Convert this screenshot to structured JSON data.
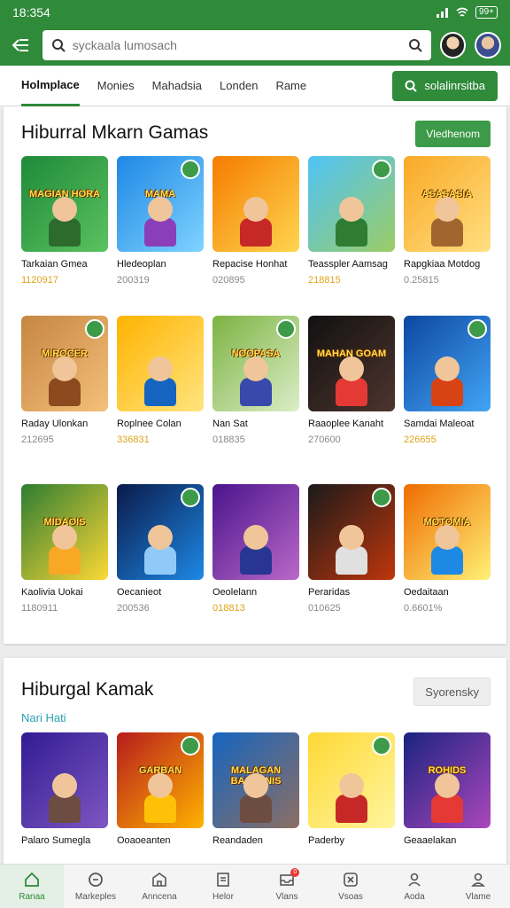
{
  "status": {
    "time": "18:354",
    "battery": "99+"
  },
  "search": {
    "placeholder": "syckaala lumosach"
  },
  "nav": {
    "tabs": [
      "Holmplace",
      "Monies",
      "Mahadsia",
      "Londen",
      "Rame"
    ],
    "cta_label": "solalinrsitba"
  },
  "section1": {
    "title": "Hiburral Mkarn Gamas",
    "button_label": "Vledhenom",
    "tiles": [
      {
        "name": "Tarkaian Gmea",
        "meta": "1120917",
        "art": "MAGIAN HORA",
        "colors": [
          "#1e8a3a",
          "#5bc25f"
        ],
        "body": "#2d6b2d"
      },
      {
        "name": "Hledeoplan",
        "meta": "200319",
        "art": "MAMA",
        "colors": [
          "#1e88e5",
          "#7fd3ff"
        ],
        "body": "#8a3fb8"
      },
      {
        "name": "Repacise Honhat",
        "meta": "020895",
        "art": "",
        "colors": [
          "#f57c00",
          "#ffd54f"
        ],
        "body": "#c62828"
      },
      {
        "name": "Teasspler Aamsag",
        "meta": "218815",
        "art": "",
        "colors": [
          "#4fc3f7",
          "#9ccc65"
        ],
        "body": "#2e7d32"
      },
      {
        "name": "Rapgkiaa Motdog",
        "meta": "0.25815",
        "art": "ASASASIA",
        "colors": [
          "#f9a825",
          "#ffe082"
        ],
        "body": "#a1662f"
      },
      {
        "name": "Raday Ulonkan",
        "meta": "212695",
        "art": "MIROCER",
        "colors": [
          "#c68642",
          "#f4c07a"
        ],
        "body": "#8d4a1f"
      },
      {
        "name": "Roplnee Colan",
        "meta": "336831",
        "art": "",
        "colors": [
          "#ffb300",
          "#ffe57f"
        ],
        "body": "#1565c0"
      },
      {
        "name": "Nan Sat",
        "meta": "018835",
        "art": "NOOPASA",
        "colors": [
          "#7cb342",
          "#dcedc8"
        ],
        "body": "#3949ab"
      },
      {
        "name": "Raaoplee Kanaht",
        "meta": "270600",
        "art": "MAHAN GOAM",
        "colors": [
          "#111111",
          "#4e342e"
        ],
        "body": "#e53935"
      },
      {
        "name": "Samdai Maleoat",
        "meta": "226655",
        "art": "",
        "colors": [
          "#0d47a1",
          "#42a5f5"
        ],
        "body": "#d84315"
      },
      {
        "name": "Kaolivia Uokai",
        "meta": "1180911",
        "art": "MIDAOIS",
        "colors": [
          "#2e7d32",
          "#fdd835"
        ],
        "body": "#f9a825"
      },
      {
        "name": "Oecanieot",
        "meta": "200536",
        "art": "",
        "colors": [
          "#0a1a4a",
          "#1e88e5"
        ],
        "body": "#90caf9"
      },
      {
        "name": "Oeolelann",
        "meta": "018813",
        "art": "",
        "colors": [
          "#4a148c",
          "#ba68c8"
        ],
        "body": "#283593"
      },
      {
        "name": "Peraridas",
        "meta": "010625",
        "art": "",
        "colors": [
          "#1a1a1a",
          "#bf360c"
        ],
        "body": "#e0e0e0"
      },
      {
        "name": "Oedaitaan",
        "meta": "0.6601%",
        "art": "MOTOMIA",
        "colors": [
          "#ef6c00",
          "#fff176"
        ],
        "body": "#1e88e5"
      }
    ]
  },
  "section2": {
    "title": "Hiburgal Kamak",
    "subtitle": "Nari Hati",
    "button_label": "Syorensky",
    "tiles": [
      {
        "name": "Palaro Sumegla",
        "meta": "",
        "art": "",
        "colors": [
          "#311b92",
          "#7e57c2"
        ],
        "body": "#6d4c41"
      },
      {
        "name": "Ooaoeanten",
        "meta": "",
        "art": "GARBAN",
        "colors": [
          "#b71c1c",
          "#ffb300"
        ],
        "body": "#ffc107"
      },
      {
        "name": "Reandaden",
        "meta": "",
        "art": "MALAGAN BASEKNIS",
        "colors": [
          "#1565c0",
          "#8d6e63"
        ],
        "body": "#6d4c41"
      },
      {
        "name": "Paderby",
        "meta": "",
        "art": "",
        "colors": [
          "#fdd835",
          "#fff59d"
        ],
        "body": "#c62828"
      },
      {
        "name": "Geaaelakan",
        "meta": "",
        "art": "ROHIDS",
        "colors": [
          "#1a237e",
          "#ab47bc"
        ],
        "body": "#e53935"
      }
    ]
  },
  "bottom_nav": [
    {
      "label": "Ranaa",
      "icon": "home-icon"
    },
    {
      "label": "Markeples",
      "icon": "chat-icon"
    },
    {
      "label": "Anncena",
      "icon": "store-icon"
    },
    {
      "label": "Helor",
      "icon": "document-icon"
    },
    {
      "label": "Vlans",
      "icon": "inbox-icon",
      "badge": "0"
    },
    {
      "label": "Vsoas",
      "icon": "close-box-icon"
    },
    {
      "label": "Aoda",
      "icon": "person-icon"
    },
    {
      "label": "Vlame",
      "icon": "profile-icon"
    }
  ]
}
